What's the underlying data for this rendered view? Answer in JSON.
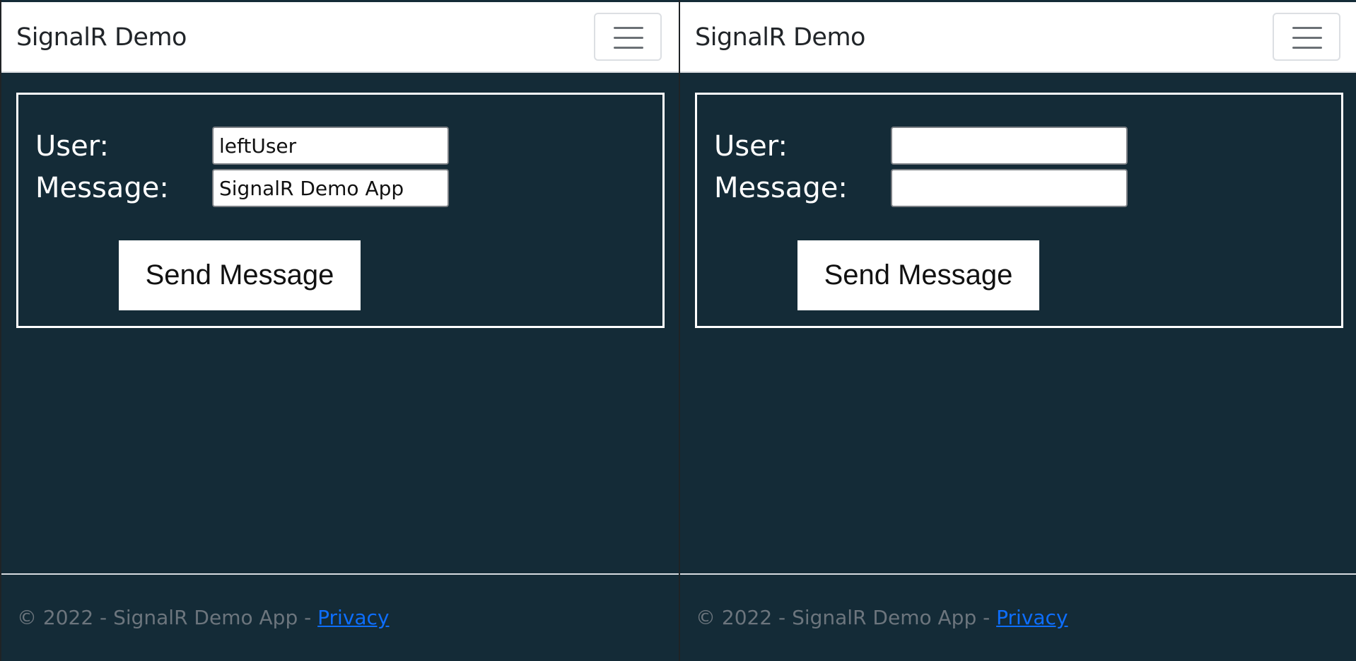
{
  "panes": [
    {
      "navbar": {
        "brand": "SignalR Demo"
      },
      "form": {
        "user_label": "User:",
        "message_label": "Message:",
        "user_value": "leftUser",
        "message_value": "SignalR Demo App",
        "send_label": "Send Message"
      },
      "footer": {
        "text": "© 2022 - SignalR Demo App - ",
        "privacy_link": "Privacy"
      }
    },
    {
      "navbar": {
        "brand": "SignalR Demo"
      },
      "form": {
        "user_label": "User:",
        "message_label": "Message:",
        "user_value": "",
        "message_value": "",
        "send_label": "Send Message"
      },
      "footer": {
        "text": "© 2022 - SignalR Demo App - ",
        "privacy_link": "Privacy"
      }
    }
  ],
  "icons": {
    "menu": "hamburger-menu-icon"
  },
  "colors": {
    "page_background": "#142b37",
    "navbar_background": "#ffffff",
    "footer_link": "#0d6efd",
    "footer_text": "#6c757d"
  }
}
